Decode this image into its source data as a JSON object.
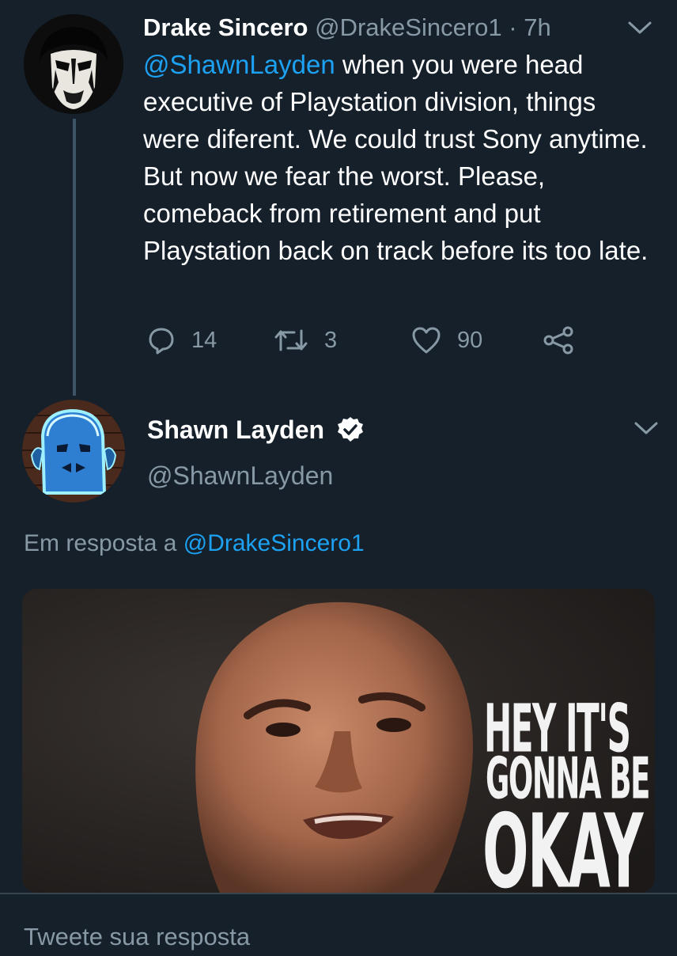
{
  "tweet1": {
    "name": "Drake Sincero",
    "handle": "@DrakeSincero1",
    "separator": "·",
    "time": "7h",
    "mention": "@ShawnLayden",
    "text": "  when you were head executive of Playstation division, things were diferent. We could trust Sony anytime. But now we fear the worst. Please, comeback from retirement  and put Playstation back on track before its too late.",
    "replies": "14",
    "retweets": "3",
    "likes": "90"
  },
  "tweet2": {
    "name": "Shawn Layden",
    "handle": "@ShawnLayden",
    "reply_prefix": "Em resposta a ",
    "reply_to": "@DrakeSincero1",
    "media_text": {
      "line1": "HEY IT'S",
      "line2": "GONNA BE",
      "line3": "OKAY"
    }
  },
  "reply_bar": {
    "placeholder": "Tweete sua resposta"
  },
  "colors": {
    "background": "#15202b",
    "link": "#1da1f2",
    "secondary_text": "#8899a6",
    "thread_line": "#3d5466"
  },
  "icons": [
    "chevron-down-icon",
    "reply-icon",
    "retweet-icon",
    "like-icon",
    "share-icon",
    "verified-badge-icon"
  ]
}
